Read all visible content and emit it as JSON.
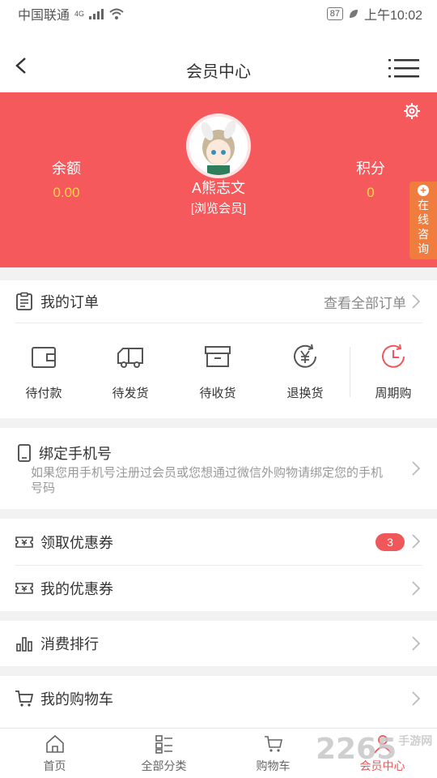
{
  "status": {
    "carrier": "中国联通",
    "network": "4G",
    "battery": "87",
    "time": "上午10:02"
  },
  "nav": {
    "title": "会员中心"
  },
  "profile": {
    "balance_label": "余额",
    "balance": "0.00",
    "points_label": "积分",
    "points": "0",
    "name": "A熊志文",
    "level": "[浏览会员]",
    "consult_label": "在线咨询"
  },
  "orders": {
    "title": "我的订单",
    "view_all": "查看全部订单",
    "items": [
      {
        "label": "待付款",
        "icon": "wallet-icon"
      },
      {
        "label": "待发货",
        "icon": "truck-icon"
      },
      {
        "label": "待收货",
        "icon": "box-icon"
      },
      {
        "label": "退换货",
        "icon": "yen-refresh-icon"
      },
      {
        "label": "周期购",
        "icon": "clock-icon"
      }
    ]
  },
  "bind": {
    "title": "绑定手机号",
    "desc": "如果您用手机号注册过会员或您想通过微信外购物请绑定您的手机号码"
  },
  "menu": {
    "claim_coupon": "领取优惠券",
    "claim_badge": "3",
    "my_coupon": "我的优惠券",
    "ranking": "消费排行",
    "cart": "我的购物车"
  },
  "tabbar": {
    "items": [
      {
        "label": "首页",
        "icon": "home-icon"
      },
      {
        "label": "全部分类",
        "icon": "category-icon"
      },
      {
        "label": "购物车",
        "icon": "cart-icon"
      },
      {
        "label": "会员中心",
        "icon": "user-icon",
        "active": true
      }
    ]
  },
  "watermark": {
    "brand": "2265",
    "site": "手游网"
  },
  "colors": {
    "accent": "#f6595c",
    "value": "#ffd54a",
    "consult": "#f07c3e"
  }
}
